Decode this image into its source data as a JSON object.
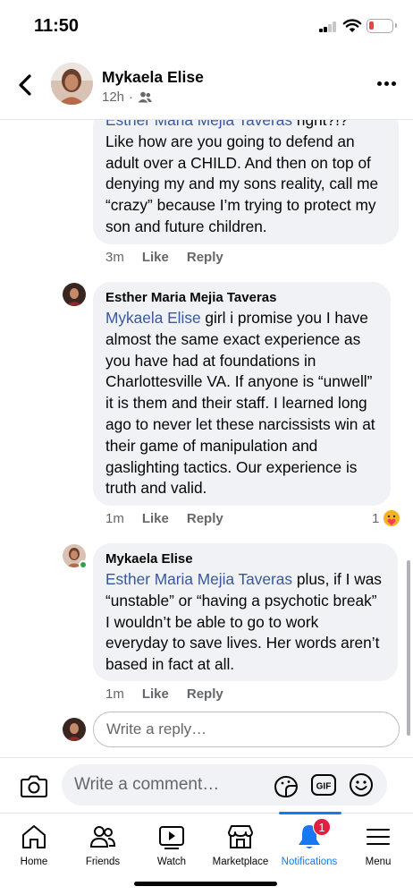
{
  "status_bar": {
    "time": "11:50",
    "icons": [
      "cellular-signal-icon",
      "wifi-icon",
      "battery-low-icon"
    ],
    "battery_color": "#e8453c"
  },
  "header": {
    "name": "Mykaela Elise",
    "time": "12h",
    "privacy_icon": "friends-icon",
    "back_icon": "chevron-left-icon",
    "more_icon": "more-horizontal-icon"
  },
  "comments": [
    {
      "mention_partial": "Esther Maria Mejia Taveras",
      "text_partial_suffix": " right?!?",
      "text": "Like how are you going to defend an adult over a CHILD. And then on top of denying my and my sons reality, call me “crazy” because I’m trying to protect my son and future children.",
      "time": "3m",
      "like": "Like",
      "reply": "Reply"
    },
    {
      "author": "Esther Maria Mejia Taveras",
      "mention": "Mykaela Elise",
      "text": " girl i promise you I have almost the same exact experience as you have had at foundations in Charlottesville VA. If anyone is “unwell” it is them and their staff. I learned long ago to never let these narcissists win at their game of manipulation and gaslighting tactics. Our experience is truth and valid.",
      "time": "1m",
      "like": "Like",
      "reply": "Reply",
      "reaction_count": "1",
      "reaction_icon": "care-reaction-icon"
    },
    {
      "author": "Mykaela Elise",
      "mention": "Esther Maria Mejia Taveras",
      "text": " plus, if I was “unstable” or “having a psychotic break” I wouldn’t be able to go to work everyday to save lives. Her words aren’t based in fact at all.",
      "time": "1m",
      "like": "Like",
      "reply": "Reply"
    }
  ],
  "reply_box": {
    "placeholder": "Write a reply…"
  },
  "composer": {
    "placeholder": "Write a comment…",
    "icons": [
      "camera-icon",
      "sticker-icon",
      "gif-icon",
      "emoji-icon"
    ],
    "gif_label": "GIF"
  },
  "tabs": [
    {
      "label": "Home",
      "icon": "home-icon",
      "active": false
    },
    {
      "label": "Friends",
      "icon": "friends-icon",
      "active": false
    },
    {
      "label": "Watch",
      "icon": "watch-icon",
      "active": false
    },
    {
      "label": "Marketplace",
      "icon": "marketplace-icon",
      "active": false
    },
    {
      "label": "Notifications",
      "icon": "bell-icon",
      "active": true,
      "badge": "1"
    },
    {
      "label": "Menu",
      "icon": "menu-icon",
      "active": false
    }
  ],
  "colors": {
    "accent": "#1877f2",
    "mention": "#385898",
    "bubble": "#f0f2f5",
    "secondary_text": "#65676b",
    "badge": "#e41e3f",
    "online": "#31a24c"
  }
}
